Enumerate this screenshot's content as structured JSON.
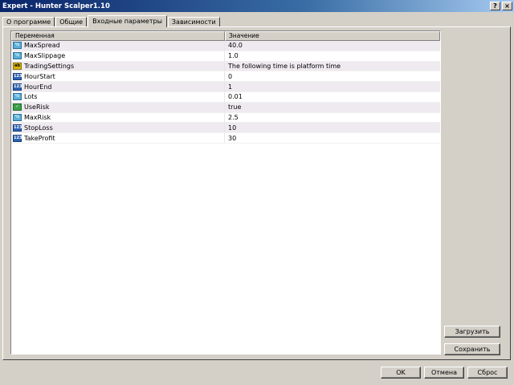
{
  "window": {
    "title": "Expert - Hunter Scalper1.10",
    "help_glyph": "?",
    "close_glyph": "×"
  },
  "tabs": [
    {
      "label": "О программе"
    },
    {
      "label": "Общие"
    },
    {
      "label": "Входные параметры"
    },
    {
      "label": "Зависимости"
    }
  ],
  "grid": {
    "headers": {
      "name": "Переменная",
      "value": "Значение"
    },
    "rows": [
      {
        "type": "dbl",
        "icon_text": "½",
        "name": "MaxSpread",
        "value": "40.0"
      },
      {
        "type": "dbl",
        "icon_text": "½",
        "name": "MaxSlippage",
        "value": "1.0"
      },
      {
        "type": "str",
        "icon_text": "ab",
        "name": "TradingSettings",
        "value": "The following time is platform time"
      },
      {
        "type": "int",
        "icon_text": "123",
        "name": "HourStart",
        "value": "0"
      },
      {
        "type": "int",
        "icon_text": "123",
        "name": "HourEnd",
        "value": "1"
      },
      {
        "type": "dbl",
        "icon_text": "½",
        "name": "Lots",
        "value": "0.01"
      },
      {
        "type": "bool",
        "icon_text": "✓",
        "name": "UseRisk",
        "value": "true"
      },
      {
        "type": "dbl",
        "icon_text": "½",
        "name": "MaxRisk",
        "value": "2.5"
      },
      {
        "type": "int",
        "icon_text": "123",
        "name": "StopLoss",
        "value": "10"
      },
      {
        "type": "int",
        "icon_text": "123",
        "name": "TakeProfit",
        "value": "30"
      }
    ]
  },
  "side_buttons": {
    "load": "Загрузить",
    "save": "Сохранить"
  },
  "footer_buttons": {
    "ok": "OK",
    "cancel": "Отмена",
    "reset": "Сброс"
  }
}
